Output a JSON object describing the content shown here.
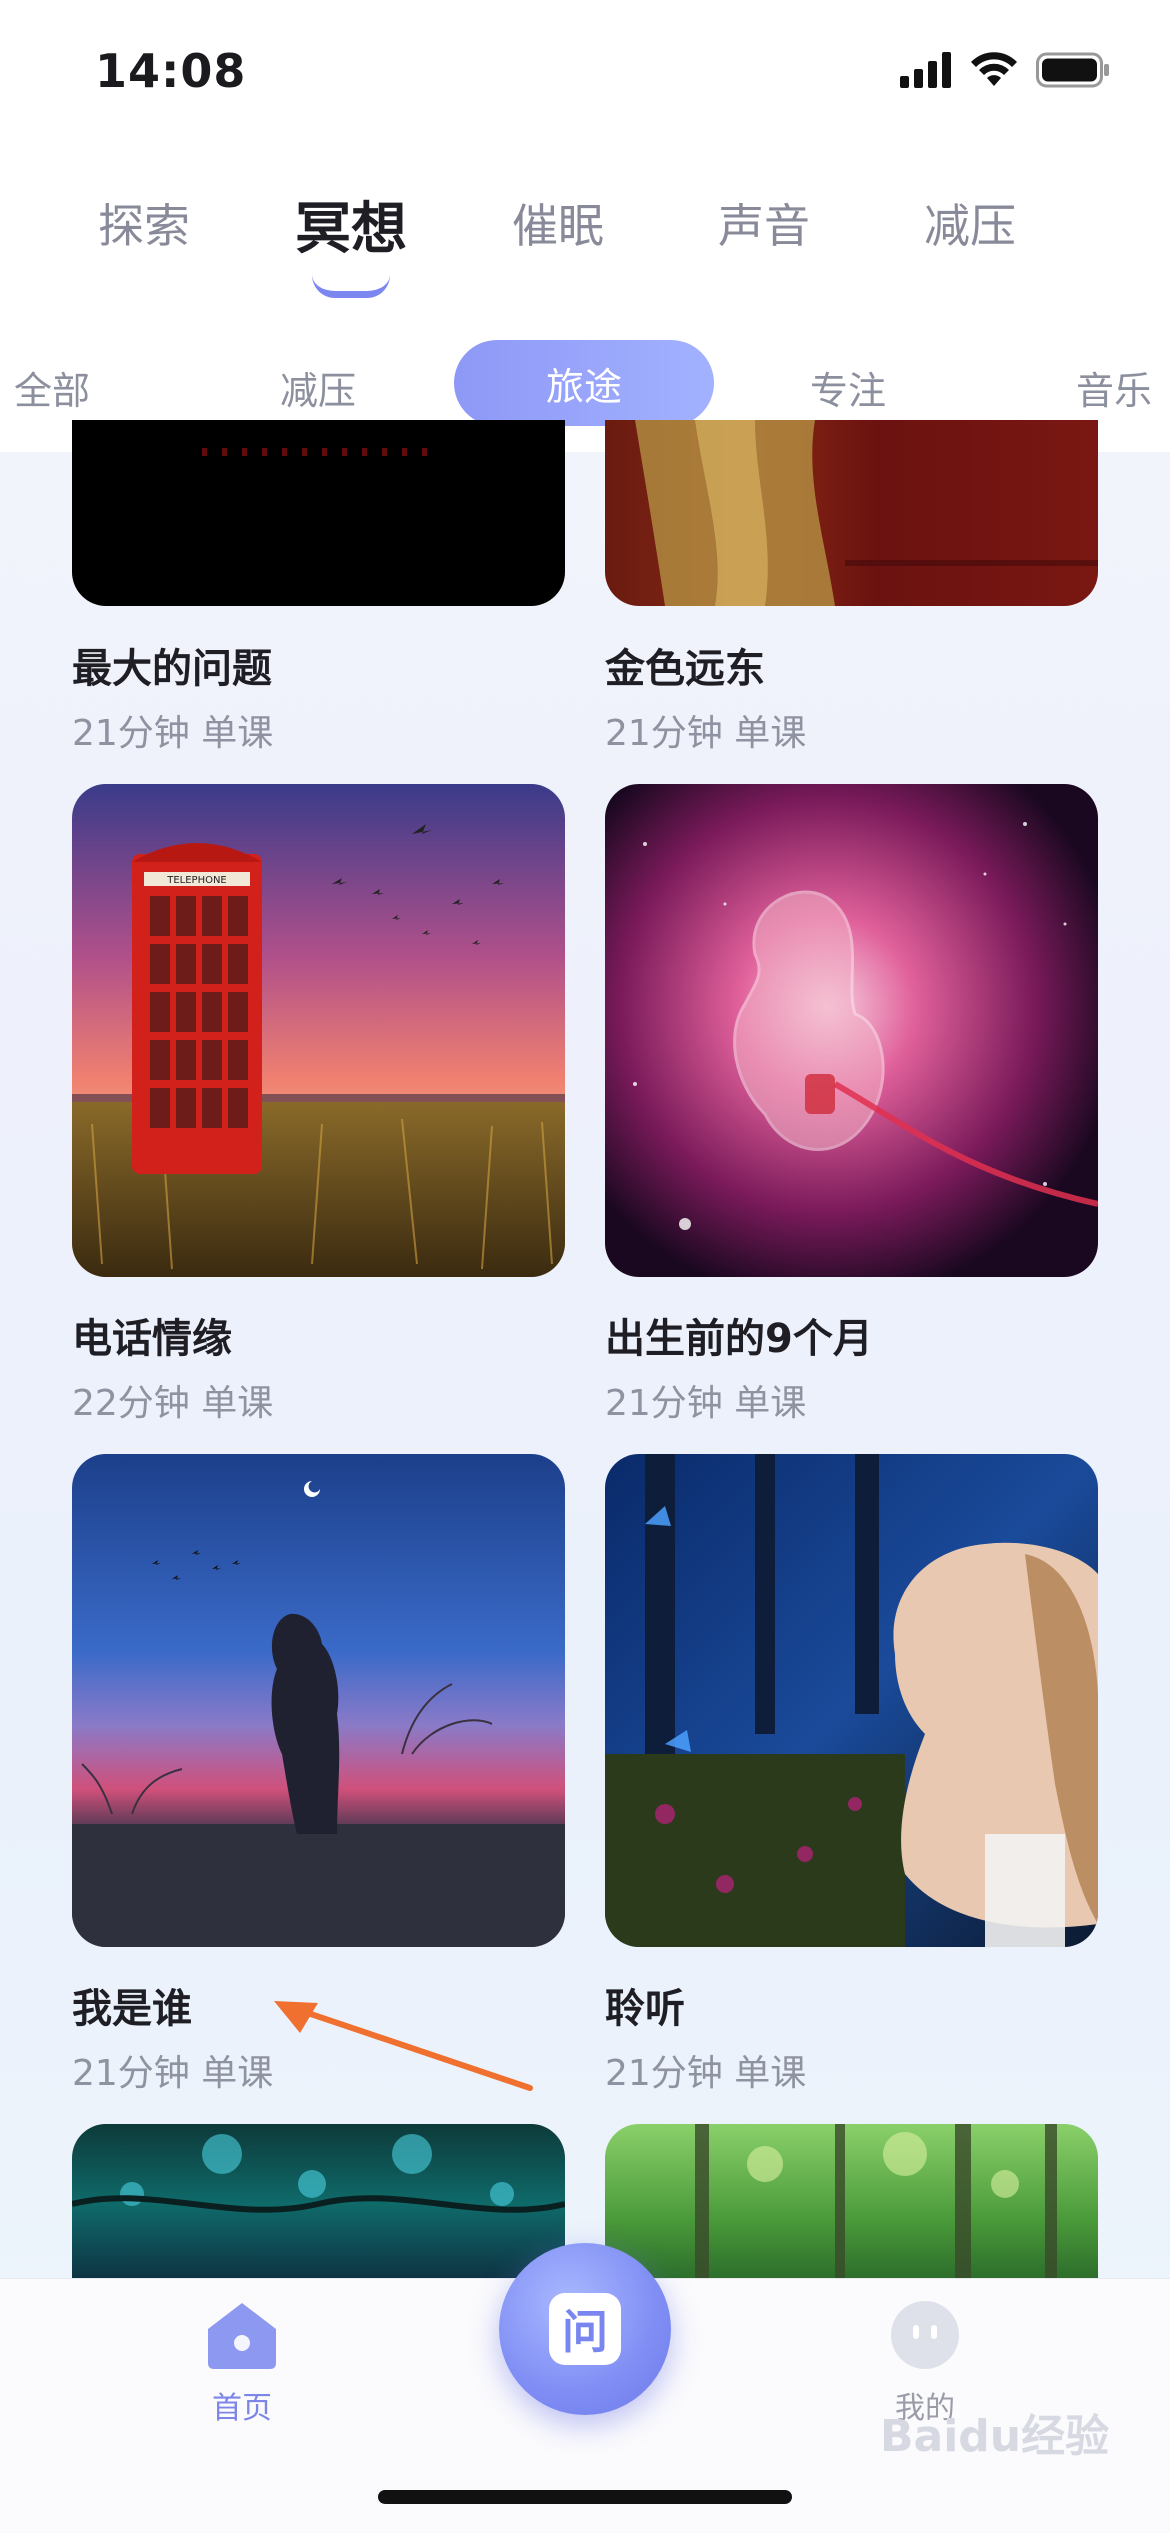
{
  "status_bar": {
    "time": "14:08"
  },
  "main_tabs": [
    {
      "label": "探索"
    },
    {
      "label": "冥想"
    },
    {
      "label": "催眠"
    },
    {
      "label": "声音"
    },
    {
      "label": "减压"
    }
  ],
  "sub_tabs": [
    {
      "label": "全部"
    },
    {
      "label": "减压"
    },
    {
      "label": "旅途"
    },
    {
      "label": "专注"
    },
    {
      "label": "音乐"
    }
  ],
  "cards": [
    {
      "title": "最大的问题",
      "meta": "21分钟 单课"
    },
    {
      "title": "金色远东",
      "meta": "21分钟 单课"
    },
    {
      "title": "电话情缘",
      "meta": "22分钟 单课"
    },
    {
      "title": "出生前的9个月",
      "meta": "21分钟 单课"
    },
    {
      "title": "我是谁",
      "meta": "21分钟 单课"
    },
    {
      "title": "聆听",
      "meta": "21分钟 单课"
    }
  ],
  "phone_booth_sign": "TELEPHONE",
  "bottom_nav": {
    "home": "首页",
    "center_glyph": "问",
    "me": "我的"
  },
  "watermark": "Baidu经验"
}
